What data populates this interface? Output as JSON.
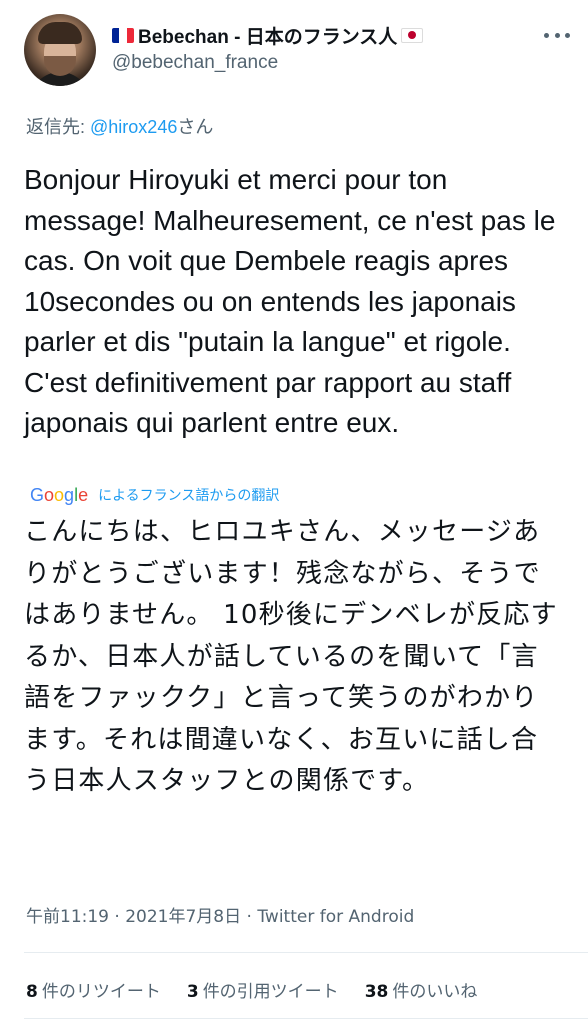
{
  "user": {
    "display_name": "Bebechan - 日本のフランス人",
    "handle": "@bebechan_france",
    "flag_left_icon": "france-flag-icon",
    "flag_right_icon": "japan-flag-icon"
  },
  "colors": {
    "text": "#0f1419",
    "secondary": "#536471",
    "link": "#1d9bf0",
    "france_blue": "#002395",
    "france_white": "#ffffff",
    "france_red": "#ed2939",
    "japan_red": "#bc002d"
  },
  "reply": {
    "prefix": "返信先: ",
    "mention": "@hirox246",
    "suffix": "さん"
  },
  "tweet": {
    "text": "Bonjour Hiroyuki et merci pour ton message! Malheuresement, ce n'est pas le cas. On voit que Dembele reagis apres 10secondes ou on entends les japonais parler et dis \"putain la langue\" et rigole. C'est definitivement par rapport au staff japonais qui parlent entre eux."
  },
  "translation": {
    "provider": "Google",
    "label": "によるフランス語からの翻訳",
    "text": "こんにちは、ヒロユキさん、メッセージありがとうございます！残念ながら、そうではありません。 10秒後にデンベレが反応するか、日本人が話しているのを聞いて「言語をファックク」と言って笑うのがわかります。それは間違いなく、お互いに話し合う日本人スタッフとの関係です。"
  },
  "meta": {
    "time": "午前11:19",
    "separator": " · ",
    "date": "2021年7月8日",
    "source": "Twitter for Android"
  },
  "stats": {
    "retweets_count": "8",
    "retweets_label": "件のリツイート",
    "quotes_count": "3",
    "quotes_label": "件の引用ツイート",
    "likes_count": "38",
    "likes_label": "件のいいね"
  }
}
